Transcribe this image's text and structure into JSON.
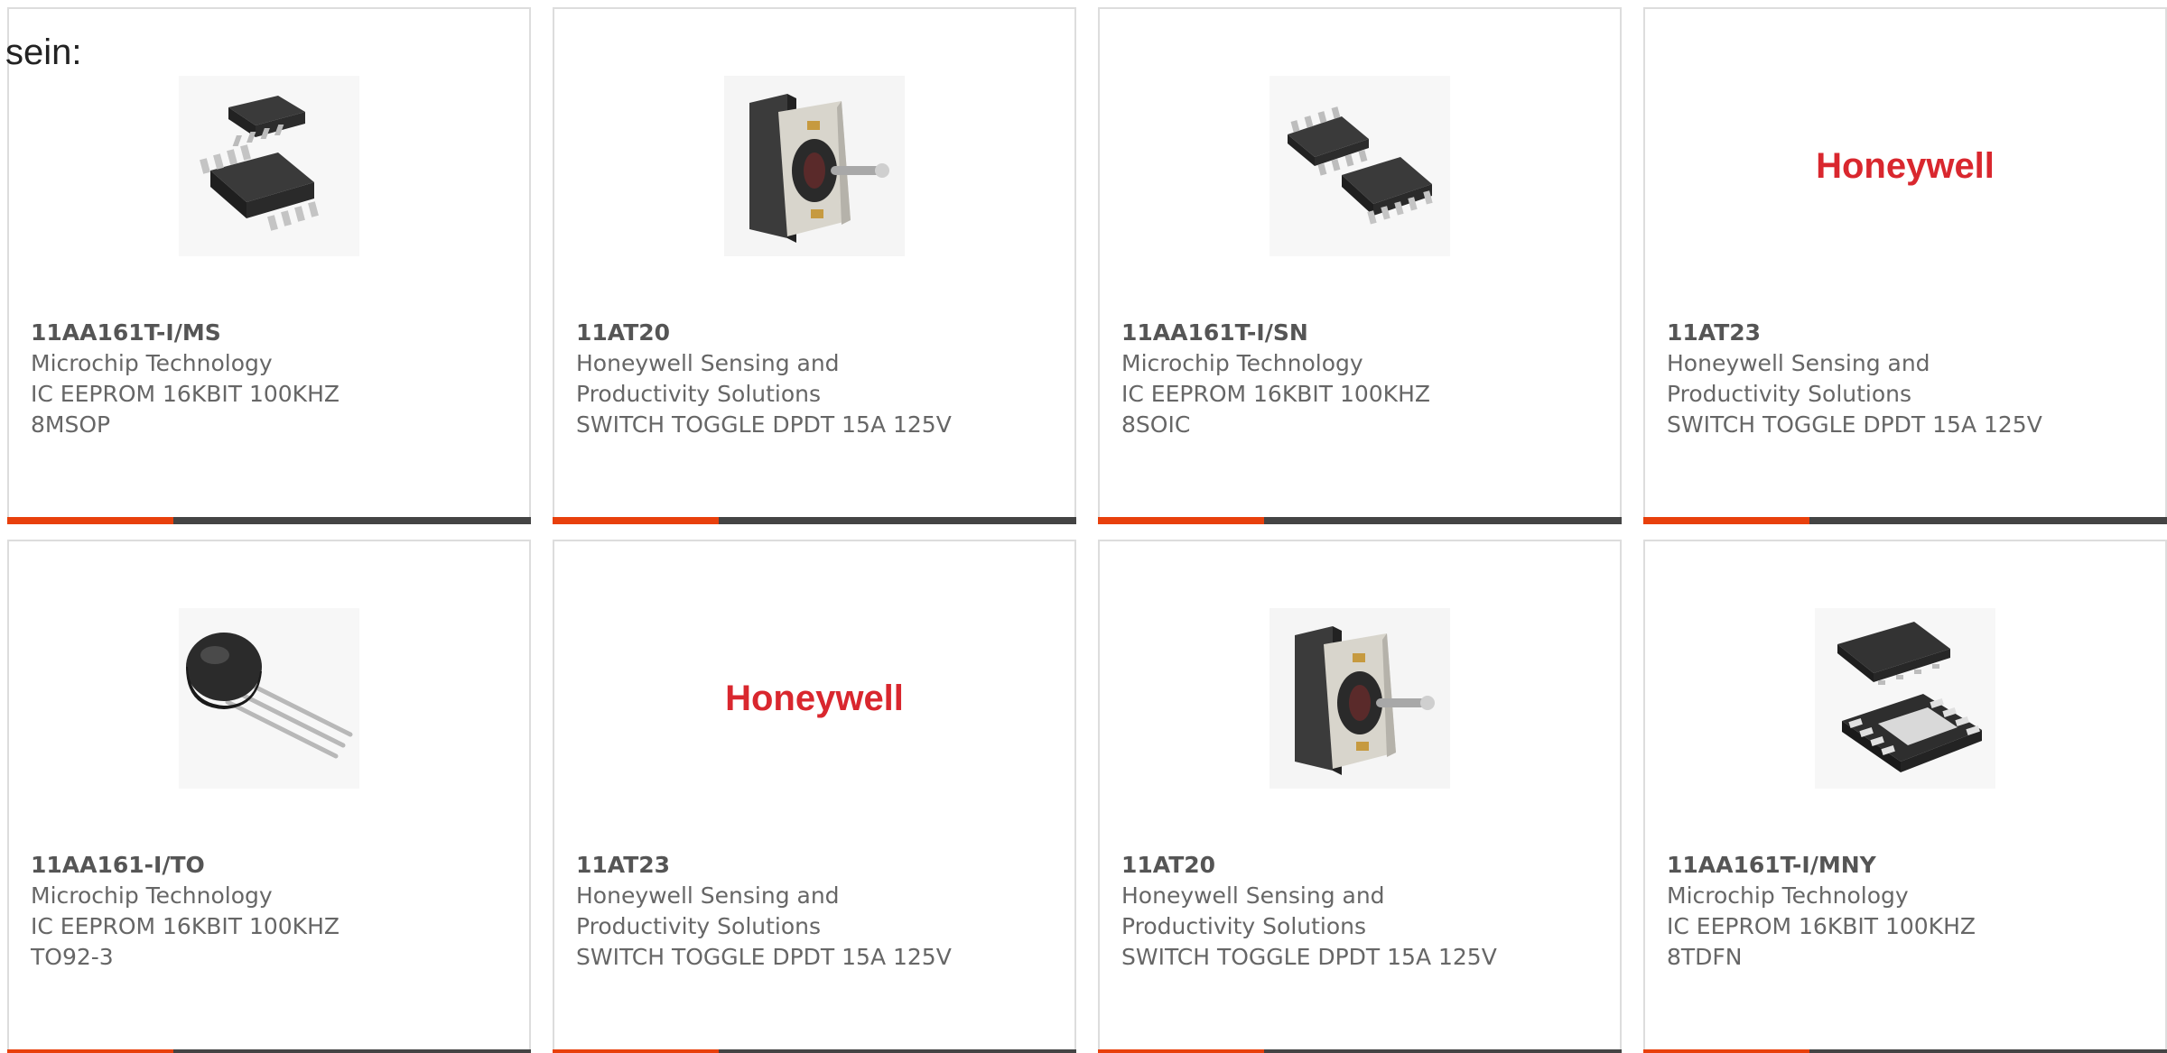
{
  "heading": "sein:",
  "colors": {
    "accent": "#e8400c",
    "bar": "#444444",
    "text": "#666666",
    "brand_red": "#d9272e"
  },
  "products": [
    {
      "part": "11AA161T-I/MS",
      "line1": "Microchip Technology",
      "line2": "IC EEPROM 16KBIT 100KHZ",
      "line3": "8MSOP",
      "image": "msop-chip-icon"
    },
    {
      "part": "11AT20",
      "line1": "Honeywell Sensing and",
      "line2": "Productivity Solutions",
      "line3": "SWITCH TOGGLE DPDT 15A 125V",
      "image": "toggle-switch-icon"
    },
    {
      "part": "11AA161T-I/SN",
      "line1": "Microchip Technology",
      "line2": "IC EEPROM 16KBIT 100KHZ",
      "line3": "8SOIC",
      "image": "soic-chip-icon"
    },
    {
      "part": "11AT23",
      "line1": "Honeywell Sensing and",
      "line2": "Productivity Solutions",
      "line3": "SWITCH TOGGLE DPDT 15A 125V",
      "image": "honeywell-logo",
      "logo_text": "Honeywell"
    },
    {
      "part": "11AA161-I/TO",
      "line1": "Microchip Technology",
      "line2": "IC EEPROM 16KBIT 100KHZ",
      "line3": "TO92-3",
      "image": "to92-transistor-icon"
    },
    {
      "part": "11AT23",
      "line1": "Honeywell Sensing and",
      "line2": "Productivity Solutions",
      "line3": "SWITCH TOGGLE DPDT 15A 125V",
      "image": "honeywell-logo",
      "logo_text": "Honeywell"
    },
    {
      "part": "11AT20",
      "line1": "Honeywell Sensing and",
      "line2": "Productivity Solutions",
      "line3": "SWITCH TOGGLE DPDT 15A 125V",
      "image": "toggle-switch-icon"
    },
    {
      "part": "11AA161T-I/MNY",
      "line1": "Microchip Technology",
      "line2": "IC EEPROM 16KBIT 100KHZ",
      "line3": "8TDFN",
      "image": "tdfn-chip-icon"
    }
  ]
}
